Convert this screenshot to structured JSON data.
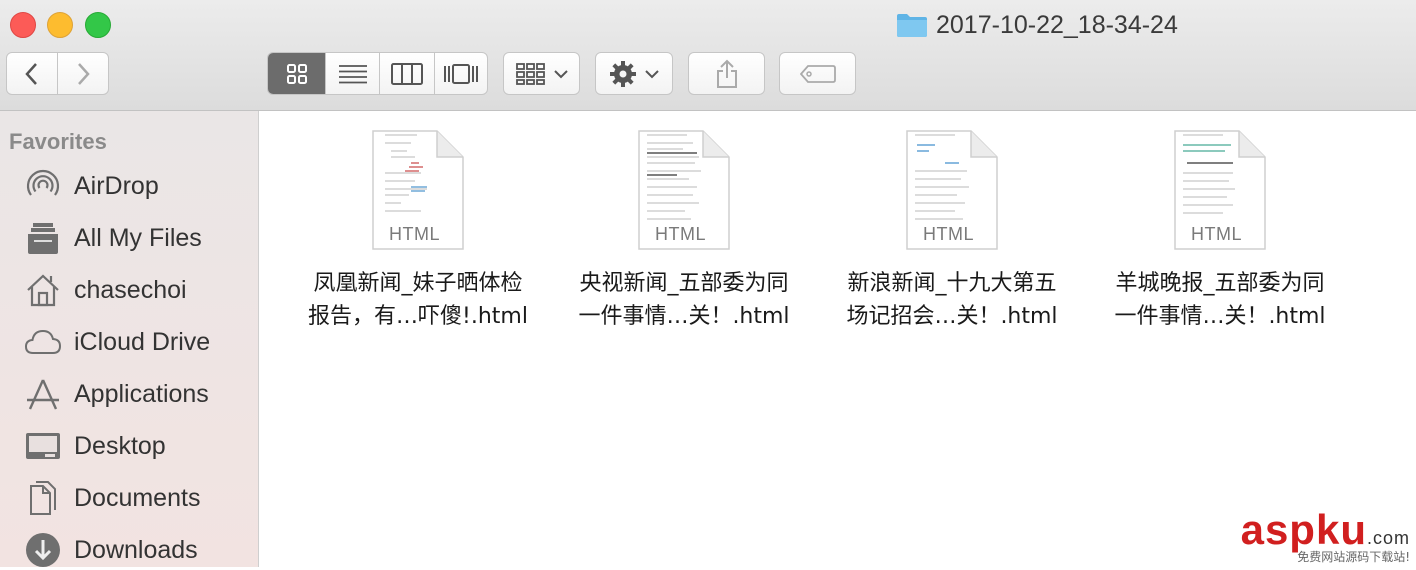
{
  "window": {
    "title": "2017-10-22_18-34-24"
  },
  "toolbar": {
    "back_icon": "chevron-left-icon",
    "forward_icon": "chevron-right-icon",
    "views": [
      "icon-view-icon",
      "list-view-icon",
      "column-view-icon",
      "cover-flow-view-icon"
    ],
    "active_view": "icon-view-icon",
    "arrange_icon": "arrange-grid-icon",
    "action_icon": "gear-icon",
    "share_icon": "share-icon",
    "tags_icon": "tag-icon"
  },
  "sidebar": {
    "heading": "Favorites",
    "items": [
      {
        "label": "AirDrop",
        "icon": "airdrop-icon"
      },
      {
        "label": "All My Files",
        "icon": "all-files-icon"
      },
      {
        "label": "chasechoi",
        "icon": "home-icon"
      },
      {
        "label": "iCloud Drive",
        "icon": "cloud-icon"
      },
      {
        "label": "Applications",
        "icon": "applications-icon"
      },
      {
        "label": "Desktop",
        "icon": "desktop-icon"
      },
      {
        "label": "Documents",
        "icon": "documents-icon"
      },
      {
        "label": "Downloads",
        "icon": "downloads-icon"
      }
    ]
  },
  "files": [
    {
      "type": "HTML",
      "name_line1": "凤凰新闻_妹子晒体检",
      "name_line2": "报告，有…吓傻!.html"
    },
    {
      "type": "HTML",
      "name_line1": "央视新闻_五部委为同",
      "name_line2": "一件事情…关！.html"
    },
    {
      "type": "HTML",
      "name_line1": "新浪新闻_十九大第五",
      "name_line2": "场记招会…关！.html"
    },
    {
      "type": "HTML",
      "name_line1": "羊城晚报_五部委为同",
      "name_line2": "一件事情…关！.html"
    }
  ],
  "watermark": {
    "main": "aspku",
    "suffix": ".com",
    "sub": "免费网站源码下载站!"
  },
  "colors": {
    "close": "#fc5b57",
    "minimize": "#fdbc2f",
    "zoom": "#33c748",
    "folder": "#5fb4e6",
    "watermark": "#d11f1f"
  }
}
